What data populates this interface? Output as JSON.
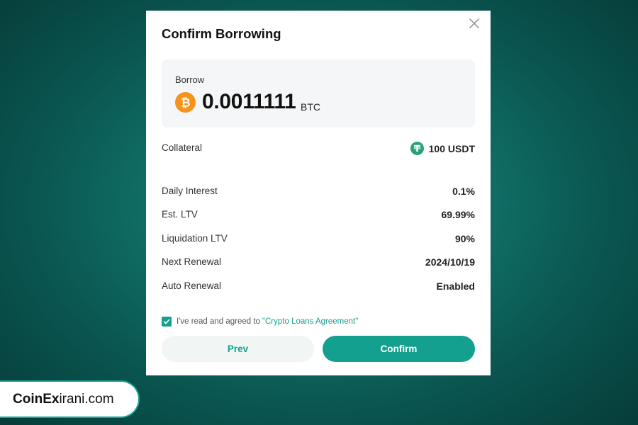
{
  "dialog": {
    "title": "Confirm Borrowing",
    "close_icon": "close-icon"
  },
  "borrow": {
    "label": "Borrow",
    "amount": "0.0011111",
    "unit": "BTC",
    "icon": "bitcoin-icon",
    "icon_color": "#f7931a"
  },
  "collateral": {
    "label": "Collateral",
    "value": "100 USDT",
    "icon": "tether-icon",
    "icon_color": "#26a17b"
  },
  "details": [
    {
      "label": "Daily Interest",
      "value": "0.1%"
    },
    {
      "label": "Est. LTV",
      "value": "69.99%"
    },
    {
      "label": "Liquidation LTV",
      "value": "90%"
    },
    {
      "label": "Next Renewal",
      "value": "2024/10/19"
    },
    {
      "label": "Auto Renewal",
      "value": "Enabled"
    }
  ],
  "agreement": {
    "checked": true,
    "text": "I've read and agreed to",
    "link": "\"Crypto Loans Agreement\""
  },
  "buttons": {
    "prev": "Prev",
    "confirm": "Confirm"
  },
  "brand": {
    "bold": "CoinEx",
    "rest": "irani.com"
  },
  "colors": {
    "accent": "#14a08f",
    "background": "#0f6b64"
  }
}
